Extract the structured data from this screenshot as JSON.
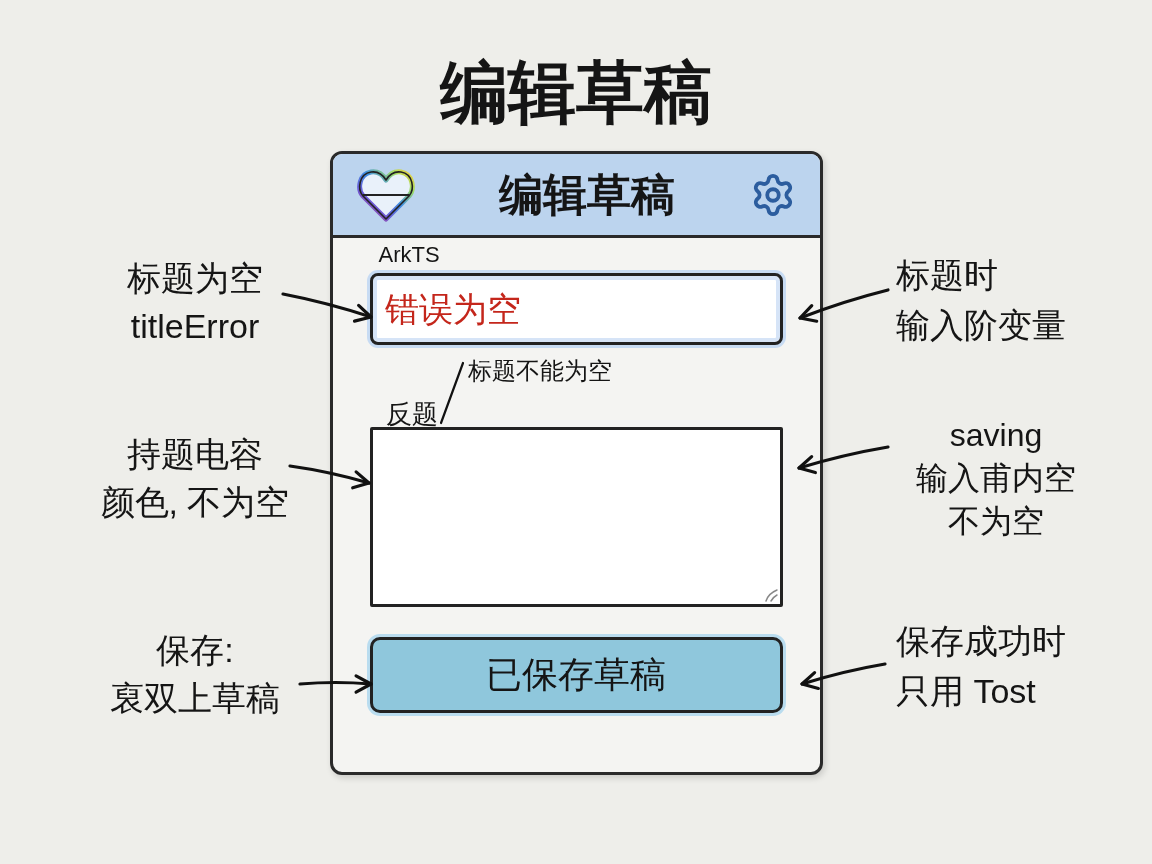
{
  "page_title": "编辑草稿",
  "app": {
    "header": {
      "title": "编辑草稿"
    },
    "title_field": {
      "label": "ArkTS",
      "value": "错误为空",
      "error": true
    },
    "error_message": "标题不能为空",
    "content_field": {
      "label": "反题"
    },
    "save_button": {
      "label": "已保存草稿"
    }
  },
  "left_notes": [
    {
      "lines": [
        "标题为空",
        "titleError"
      ]
    },
    {
      "lines": [
        "持题电容",
        "颜色, 不为空"
      ]
    },
    {
      "lines": [
        "保存:",
        "裒双上草稿"
      ]
    }
  ],
  "right_notes": [
    {
      "lines": [
        "标题时",
        "输入阶变量"
      ]
    },
    {
      "lines": [
        "saving",
        "输入甫内空",
        "不为空"
      ]
    },
    {
      "lines": [
        "保存成功时",
        "只用 Tost"
      ]
    }
  ]
}
